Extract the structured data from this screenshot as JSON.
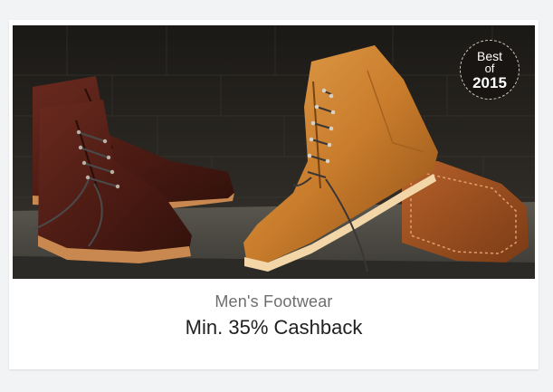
{
  "card": {
    "category": "Men's Footwear",
    "offer": "Min. 35% Cashback",
    "badge": {
      "line1": "Best",
      "line2": "of",
      "year": "2015"
    },
    "image_subject": "boots-photo"
  },
  "colors": {
    "page_bg": "#f2f3f5",
    "card_bg": "#ffffff",
    "category_text": "#6e6e6e",
    "offer_text": "#212121",
    "badge_bg": "#181512"
  }
}
